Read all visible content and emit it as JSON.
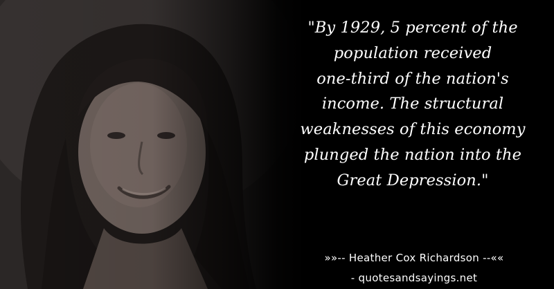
{
  "quote": {
    "text": "\"By 1929, 5 percent of the\npopulation received\none-third of the nation's\nincome. The structural\nweaknesses of this economy\nplunged the nation into the\nGreat Depression.\""
  },
  "attribution": {
    "text": "»»-- Heather Cox Richardson --««"
  },
  "site": {
    "text": "- quotesandsayings.net"
  },
  "colors": {
    "background": "#000000",
    "text": "#ffffff"
  }
}
